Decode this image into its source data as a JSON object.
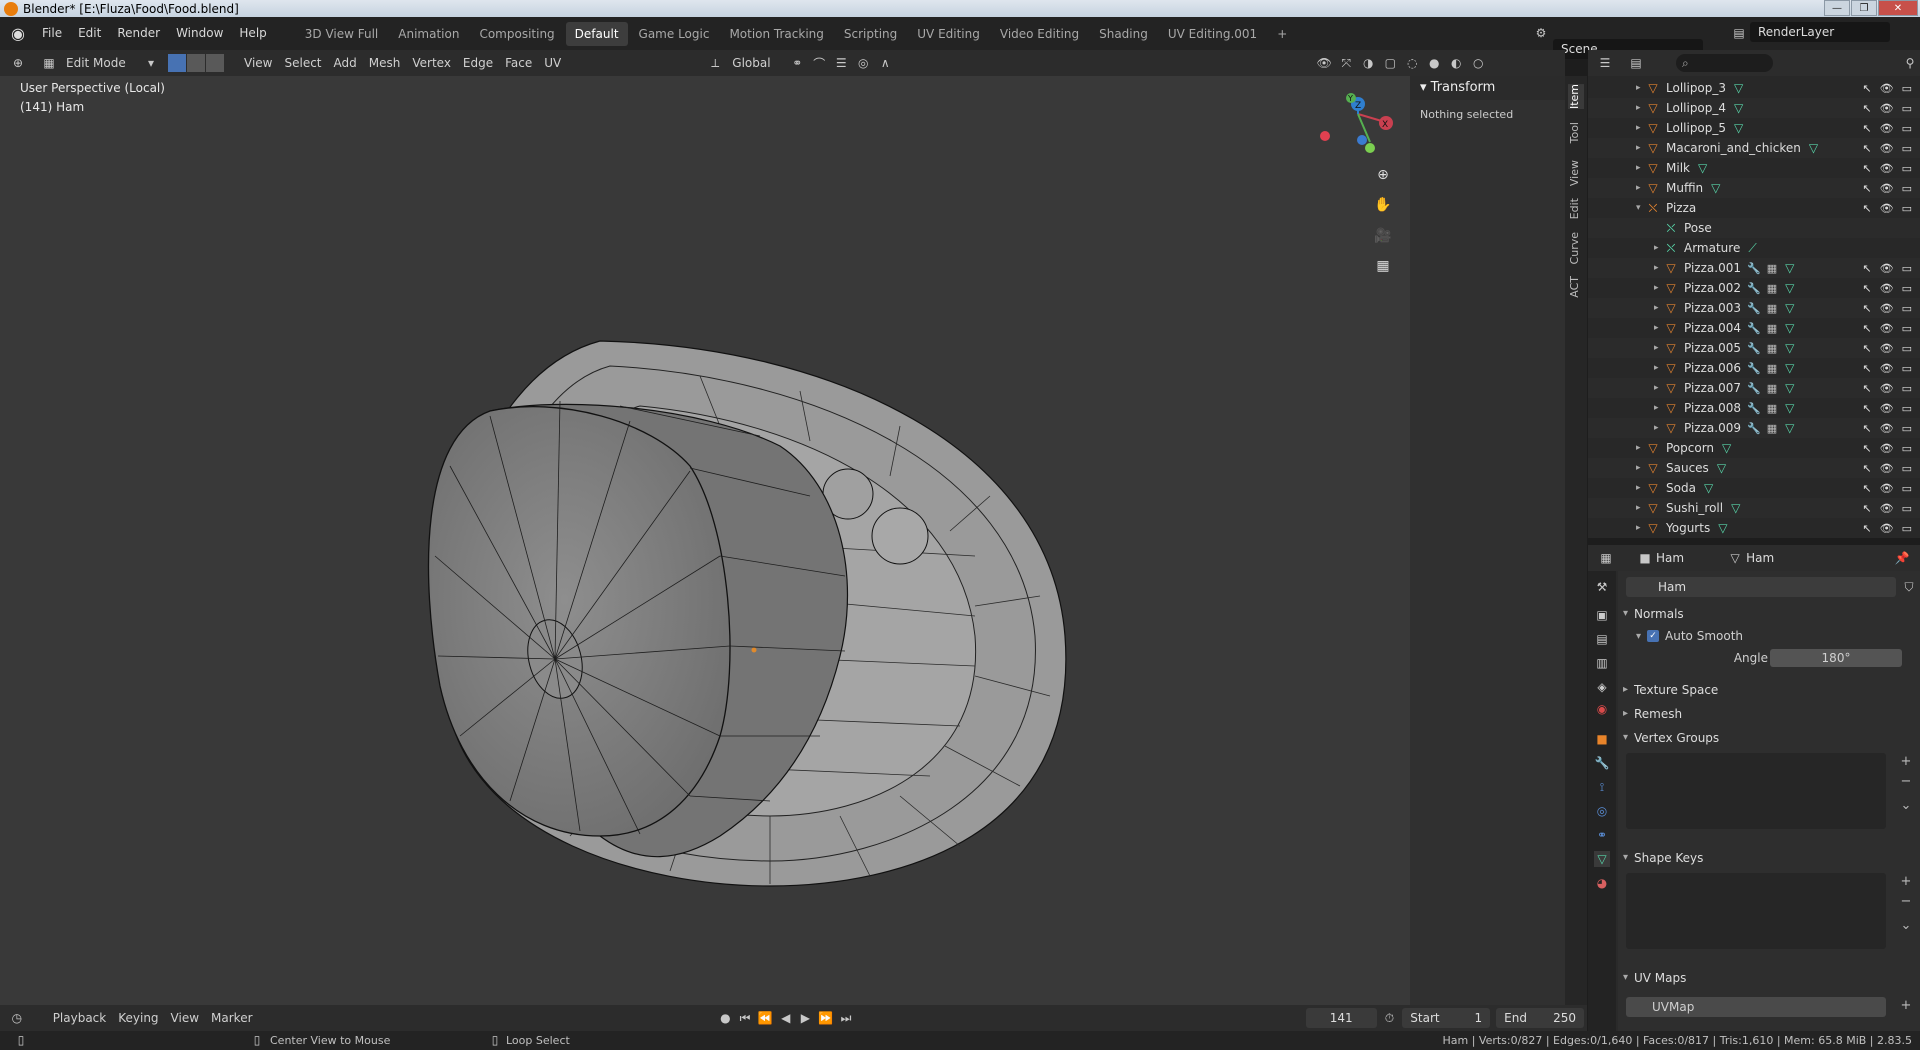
{
  "window": {
    "title": "Blender* [E:\\Fluza\\Food\\Food.blend]",
    "buttons": [
      "—",
      "❐",
      "✕"
    ]
  },
  "menu": [
    "File",
    "Edit",
    "Render",
    "Window",
    "Help"
  ],
  "workspaces": [
    {
      "label": "3D View Full",
      "active": false
    },
    {
      "label": "Animation",
      "active": false
    },
    {
      "label": "Compositing",
      "active": false
    },
    {
      "label": "Default",
      "active": true
    },
    {
      "label": "Game Logic",
      "active": false
    },
    {
      "label": "Motion Tracking",
      "active": false
    },
    {
      "label": "Scripting",
      "active": false
    },
    {
      "label": "UV Editing",
      "active": false
    },
    {
      "label": "Video Editing",
      "active": false
    },
    {
      "label": "Shading",
      "active": false
    },
    {
      "label": "UV Editing.001",
      "active": false
    }
  ],
  "add_workspace": "+",
  "scene": {
    "name": "Scene",
    "render_layer": "RenderLayer"
  },
  "viewport_header": {
    "mode": "Edit Mode",
    "menus": [
      "View",
      "Select",
      "Add",
      "Mesh",
      "Vertex",
      "Edge",
      "Face",
      "UV"
    ],
    "orientation": "Global"
  },
  "viewport": {
    "perspective": "User Perspective (Local)",
    "object_info": "(141) Ham",
    "gizmo": {
      "x": "X",
      "y": "Y",
      "z": "Z"
    }
  },
  "npanel": {
    "transform_title": "Transform",
    "transform_body": "Nothing selected",
    "tabs": [
      "Item",
      "Tool",
      "View",
      "Edit",
      "Curve",
      "ACT"
    ]
  },
  "outliner": {
    "rows": [
      {
        "name": "Lollipop_3",
        "indent": 0,
        "type": "mesh",
        "mods": false
      },
      {
        "name": "Lollipop_4",
        "indent": 0,
        "type": "mesh",
        "mods": false
      },
      {
        "name": "Lollipop_5",
        "indent": 0,
        "type": "mesh",
        "mods": false
      },
      {
        "name": "Macaroni_and_chicken",
        "indent": 0,
        "type": "mesh",
        "mods": false
      },
      {
        "name": "Milk",
        "indent": 0,
        "type": "mesh",
        "mods": false
      },
      {
        "name": "Muffin",
        "indent": 0,
        "type": "mesh",
        "mods": false
      },
      {
        "name": "Pizza",
        "indent": 0,
        "type": "armature-object",
        "mods": false,
        "expanded": true
      },
      {
        "name": "Pose",
        "indent": 1,
        "type": "pose",
        "mods": false
      },
      {
        "name": "Armature",
        "indent": 1,
        "type": "armature",
        "mods": false
      },
      {
        "name": "Pizza.001",
        "indent": 1,
        "type": "mesh",
        "mods": true
      },
      {
        "name": "Pizza.002",
        "indent": 1,
        "type": "mesh",
        "mods": true
      },
      {
        "name": "Pizza.003",
        "indent": 1,
        "type": "mesh",
        "mods": true
      },
      {
        "name": "Pizza.004",
        "indent": 1,
        "type": "mesh",
        "mods": true
      },
      {
        "name": "Pizza.005",
        "indent": 1,
        "type": "mesh",
        "mods": true
      },
      {
        "name": "Pizza.006",
        "indent": 1,
        "type": "mesh",
        "mods": true
      },
      {
        "name": "Pizza.007",
        "indent": 1,
        "type": "mesh",
        "mods": true
      },
      {
        "name": "Pizza.008",
        "indent": 1,
        "type": "mesh",
        "mods": true
      },
      {
        "name": "Pizza.009",
        "indent": 1,
        "type": "mesh",
        "mods": true
      },
      {
        "name": "Popcorn",
        "indent": 0,
        "type": "mesh",
        "mods": false
      },
      {
        "name": "Sauces",
        "indent": 0,
        "type": "mesh",
        "mods": false
      },
      {
        "name": "Soda",
        "indent": 0,
        "type": "mesh",
        "mods": false
      },
      {
        "name": "Sushi_roll",
        "indent": 0,
        "type": "mesh",
        "mods": false
      },
      {
        "name": "Yogurts",
        "indent": 0,
        "type": "mesh",
        "mods": false
      }
    ]
  },
  "properties": {
    "breadcrumb_object": "Ham",
    "breadcrumb_mesh": "Ham",
    "mesh_name": "Ham",
    "sections": {
      "normals": "Normals",
      "auto_smooth": "Auto Smooth",
      "angle_label": "Angle",
      "angle_value": "180°",
      "texture_space": "Texture Space",
      "remesh": "Remesh",
      "vertex_groups": "Vertex Groups",
      "shape_keys": "Shape Keys",
      "uv_maps": "UV Maps",
      "uvmap_item": "UVMap"
    }
  },
  "timeline": {
    "menus": [
      "Playback",
      "Keying",
      "View",
      "Marker"
    ],
    "current_frame": "141",
    "start_label": "Start",
    "start": "1",
    "end_label": "End",
    "end": "250"
  },
  "statusbar": {
    "hint1": "Center View to Mouse",
    "hint2": "Loop Select",
    "stats": "Ham | Verts:0/827 | Edges:0/1,640 | Faces:0/817 | Tris:1,610 | Mem: 65.8 MiB | 2.83.5"
  },
  "colors": {
    "accent": "#4772b3",
    "object_orange": "#e3832f",
    "mesh_green": "#58d4a8"
  }
}
